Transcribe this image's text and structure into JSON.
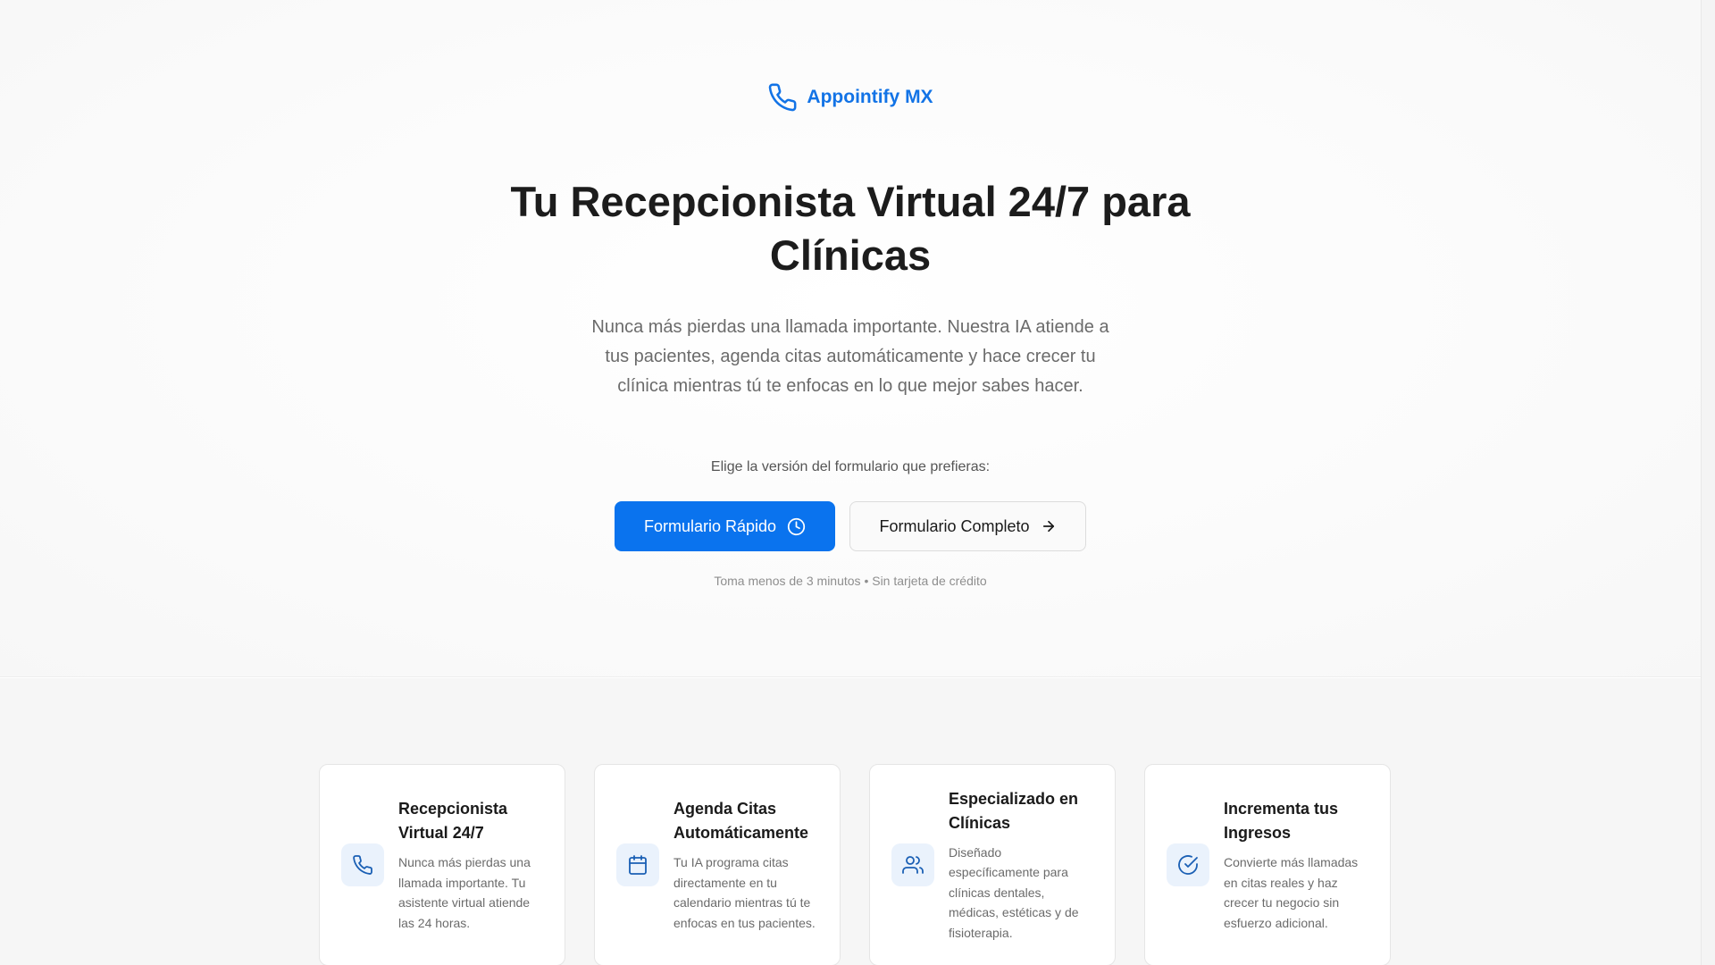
{
  "brand": {
    "name": "Appointify MX",
    "icon": "phone-icon",
    "color": "#1273e6"
  },
  "hero": {
    "headline_line1": "Tu Recepcionista Virtual 24/7 para",
    "headline_line2": "Clínicas",
    "subtitle": "Nunca más pierdas una llamada importante. Nuestra IA atiende a tus pacientes, agenda citas automáticamente y hace crecer tu clínica mientras tú te enfocas en lo que mejor sabes hacer.",
    "choose_label": "Elige la versión del formulario que prefieras:",
    "primary_cta": {
      "label": "Formulario Rápido",
      "icon": "clock-icon",
      "color": "#0a73ee"
    },
    "secondary_cta": {
      "label": "Formulario Completo",
      "icon": "arrow-right-icon"
    },
    "note": "Toma menos de 3 minutos • Sin tarjeta de crédito"
  },
  "features": [
    {
      "icon": "phone-icon",
      "title": "Recepcionista Virtual 24/7",
      "description": "Nunca más pierdas una llamada importante. Tu asistente virtual atiende las 24 horas."
    },
    {
      "icon": "calendar-icon",
      "title": "Agenda Citas Automáticamente",
      "description": "Tu IA programa citas directamente en tu calendario mientras tú te enfocas en tus pacientes."
    },
    {
      "icon": "users-icon",
      "title": "Especializado en Clínicas",
      "description": "Diseñado específicamente para clínicas dentales, médicas, estéticas y de fisioterapia."
    },
    {
      "icon": "check-circle-icon",
      "title": "Incrementa tus Ingresos",
      "description": "Convierte más llamadas en citas reales y haz crecer tu negocio sin esfuerzo adicional."
    }
  ]
}
